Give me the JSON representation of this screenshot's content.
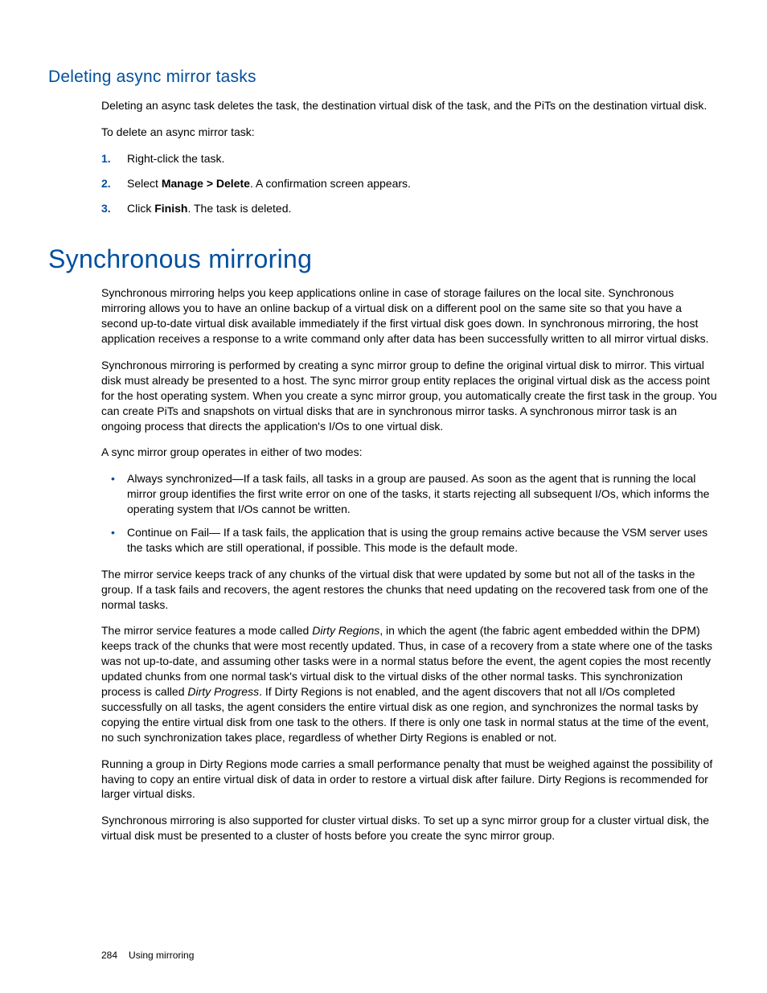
{
  "section1": {
    "title": "Deleting async mirror tasks",
    "p1": "Deleting an async task deletes the task, the destination virtual disk of the task, and the PiTs on the destination virtual disk.",
    "p2": "To delete an async mirror task:",
    "steps": {
      "s1": "Right-click the task.",
      "s2_a": "Select ",
      "s2_b": "Manage > Delete",
      "s2_c": ". A confirmation screen appears.",
      "s3_a": "Click ",
      "s3_b": "Finish",
      "s3_c": ". The task is deleted."
    }
  },
  "section2": {
    "title": "Synchronous mirroring",
    "p1": "Synchronous mirroring helps you keep applications online in case of storage failures on the local site. Synchronous mirroring allows you to have an online backup of a virtual disk on a different pool on the same site so that you have a second up-to-date virtual disk available immediately if the first virtual disk goes down. In synchronous mirroring, the host application receives a response to a write command only after data has been successfully written to all mirror virtual disks.",
    "p2": "Synchronous mirroring is performed by creating a sync mirror group to define the original virtual disk to mirror. This virtual disk must already be presented to a host. The sync mirror group entity replaces the original virtual disk as the access point for the host operating system. When you create a sync mirror group, you automatically create the first task in the group. You can create PiTs and snapshots on virtual disks that are in synchronous mirror tasks. A synchronous mirror task is an ongoing process that directs the application's I/Os to one virtual disk.",
    "p3": "A sync mirror group operates in either of two modes:",
    "bullets": {
      "b1": "Always synchronized—If a task fails, all tasks in a group are paused. As soon as the agent that is running the local mirror group identifies the first write error on one of the tasks, it starts rejecting all subsequent I/Os, which informs the operating system that I/Os cannot be written.",
      "b2": "Continue on Fail— If a task fails, the application that is using the group remains active because the VSM server uses the tasks which are still operational, if possible. This mode is the default mode."
    },
    "p4": "The mirror service keeps track of any chunks of the virtual disk that were updated by some but not all of the tasks in the group. If a task fails and recovers, the agent restores the chunks that need updating on the recovered task from one of the normal tasks.",
    "p5_a": "The mirror service features a mode called ",
    "p5_b": "Dirty Regions",
    "p5_c": ", in which the agent (the fabric agent embedded within the DPM) keeps track of the chunks that were most recently updated. Thus, in case of a recovery from a state where one of the tasks was not up-to-date, and assuming other tasks were in a normal status before the event, the agent copies the most recently updated chunks from one normal task's virtual disk to the virtual disks of the other normal tasks. This synchronization process is called ",
    "p5_d": "Dirty Progress",
    "p5_e": ". If Dirty Regions is not enabled, and the agent discovers that not all I/Os completed successfully on all tasks, the agent considers the entire virtual disk as one region, and synchronizes the normal tasks by copying the entire virtual disk from one task to the others. If there is only one task in normal status at the time of the event, no such synchronization takes place, regardless of whether Dirty Regions is enabled or not.",
    "p6": "Running a group in Dirty Regions mode carries a small performance penalty that must be weighed against the possibility of having to copy an entire virtual disk of data in order to restore a virtual disk after failure. Dirty Regions is recommended for larger virtual disks.",
    "p7": "Synchronous mirroring is also supported for cluster virtual disks. To set up a sync mirror group for a cluster virtual disk, the virtual disk must be presented to a cluster of hosts before you create the sync mirror group."
  },
  "footer": {
    "page": "284",
    "chapter": "Using mirroring"
  }
}
